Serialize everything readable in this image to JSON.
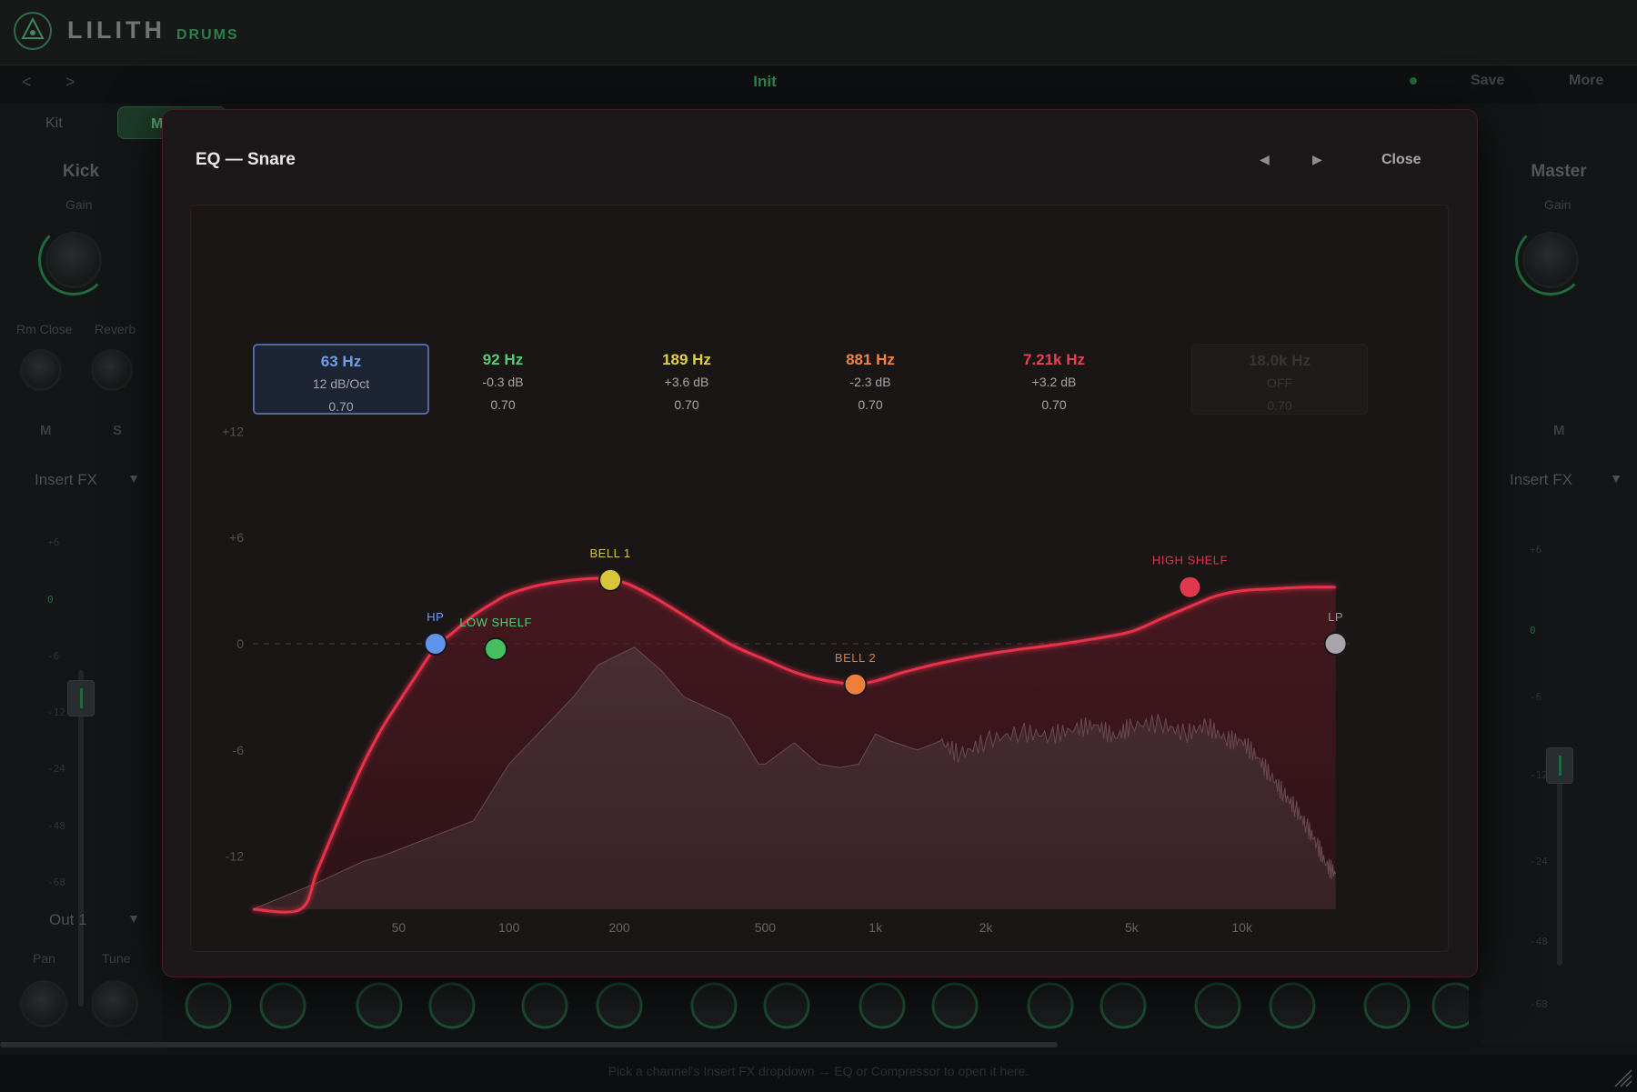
{
  "app": {
    "brand": "LILITH",
    "brand_sub": "DRUMS",
    "preset_name": "Init",
    "prev_label": "<",
    "next_label": ">",
    "save_label": "Save",
    "more_label": "More",
    "tabs": [
      {
        "label": "Kit"
      },
      {
        "label": "M"
      }
    ],
    "status_hint": "Pick a channel's Insert FX dropdown → EQ or Compressor to open it here."
  },
  "channels": {
    "kick": {
      "title": "Kick",
      "gain_label": "Gain",
      "rm_close_label": "Rm Close",
      "reverb_label": "Reverb",
      "mute_label": "M",
      "solo_label": "S",
      "insert_label": "Insert FX",
      "output_label": "Out 1",
      "pan_label": "Pan",
      "tune_label": "Tune",
      "meter_scale": [
        "+6",
        "0",
        "-6",
        "-12",
        "-24",
        "-48",
        "-68"
      ]
    },
    "master": {
      "title": "Master",
      "gain_label": "Gain",
      "mute_label": "M",
      "insert_label": "Insert FX",
      "meter_scale": [
        "+6",
        "0",
        "-6",
        "-12",
        "-24",
        "-48",
        "-68"
      ]
    }
  },
  "eq_modal": {
    "title": "EQ — Snare",
    "prev_icon": "◀",
    "next_icon": "▶",
    "close_label": "Close",
    "bands": [
      {
        "freq": "63 Hz",
        "gain": "12 dB/Oct",
        "q": "0.70",
        "color": "#6f9fe8",
        "state": "active"
      },
      {
        "freq": "92 Hz",
        "gain": "-0.3 dB",
        "q": "0.70",
        "color": "#4fcf72",
        "state": "on"
      },
      {
        "freq": "189 Hz",
        "gain": "+3.6 dB",
        "q": "0.70",
        "color": "#e3cf45",
        "state": "on"
      },
      {
        "freq": "881 Hz",
        "gain": "-2.3 dB",
        "q": "0.70",
        "color": "#ef8540",
        "state": "on"
      },
      {
        "freq": "7.21k Hz",
        "gain": "+3.2 dB",
        "q": "0.70",
        "color": "#e84050",
        "state": "on"
      },
      {
        "freq": "18.0k Hz",
        "gain": "OFF",
        "q": "0.70",
        "color": "#3a3535",
        "state": "off"
      }
    ],
    "nodes": [
      {
        "label": "HP",
        "freq_hz": 63,
        "gain_db": 0,
        "color": "#5e95ea",
        "label_color": "#6f9fe8"
      },
      {
        "label": "LOW SHELF",
        "freq_hz": 92,
        "gain_db": -0.3,
        "color": "#44c060",
        "label_color": "#4fcf72"
      },
      {
        "label": "BELL 1",
        "freq_hz": 189,
        "gain_db": 3.6,
        "color": "#d9c53a",
        "label_color": "#d9c53a"
      },
      {
        "label": "BELL 2",
        "freq_hz": 881,
        "gain_db": -2.3,
        "color": "#ee7f3a",
        "label_color": "#e07a3a"
      },
      {
        "label": "HIGH SHELF",
        "freq_hz": 7210,
        "gain_db": 3.2,
        "color": "#e0394d",
        "label_color": "#d8384c"
      },
      {
        "label": "LP",
        "freq_hz": 18000,
        "gain_db": 0,
        "color": "#a9a3aa",
        "label_color": "#9a9497"
      }
    ],
    "chart_data": {
      "type": "line",
      "x_scale": "log",
      "xlim_hz": [
        20,
        20000
      ],
      "ylim_db": [
        -15,
        15
      ],
      "y_ticks": [
        {
          "value": 12,
          "label": "+12"
        },
        {
          "value": 6,
          "label": "+6"
        },
        {
          "value": 0,
          "label": "0"
        },
        {
          "value": -6,
          "label": "-6"
        },
        {
          "value": -12,
          "label": "-12"
        }
      ],
      "x_ticks": [
        {
          "value": 50,
          "label": "50"
        },
        {
          "value": 100,
          "label": "100"
        },
        {
          "value": 200,
          "label": "200"
        },
        {
          "value": 500,
          "label": "500"
        },
        {
          "value": 1000,
          "label": "1k"
        },
        {
          "value": 2000,
          "label": "2k"
        },
        {
          "value": 5000,
          "label": "5k"
        },
        {
          "value": 10000,
          "label": "10k"
        }
      ],
      "curve_color": "#e8304a",
      "response_curve": {
        "freq_hz": [
          20,
          27,
          30,
          35,
          40,
          45,
          50,
          55,
          63,
          70,
          80,
          92,
          100,
          120,
          150,
          175,
          189,
          210,
          250,
          300,
          400,
          500,
          600,
          700,
          800,
          881,
          1000,
          1200,
          1500,
          2000,
          2500,
          3000,
          4000,
          5000,
          6000,
          7210,
          8500,
          10000,
          12000,
          15000,
          18000
        ],
        "gain_db": [
          -15,
          -15,
          -12.8,
          -9.5,
          -6.8,
          -4.8,
          -3.3,
          -2.0,
          -0.2,
          0.6,
          1.6,
          2.4,
          2.8,
          3.3,
          3.6,
          3.7,
          3.6,
          3.4,
          2.6,
          1.6,
          0.0,
          -0.9,
          -1.6,
          -2.0,
          -2.2,
          -2.3,
          -2.1,
          -1.6,
          -1.1,
          -0.6,
          -0.3,
          -0.1,
          0.3,
          0.7,
          1.4,
          2.1,
          2.7,
          3.0,
          3.1,
          3.2,
          3.2
        ]
      },
      "spectrum": {
        "freq_hz": [
          20,
          30,
          40,
          45,
          60,
          80,
          100,
          150,
          175,
          200,
          220,
          260,
          300,
          400,
          440,
          480,
          500,
          600,
          700,
          800,
          900,
          1000,
          1100,
          1300,
          1500,
          1700,
          2000,
          2500,
          3000,
          3500,
          4000,
          4500,
          5000,
          6000,
          7000,
          8000,
          9000,
          10000,
          11000,
          12000,
          13000,
          14000,
          15000,
          16000,
          17000,
          18000
        ],
        "gain_db": [
          -15,
          -13.5,
          -12.3,
          -12.0,
          -11.0,
          -10.0,
          -6.8,
          -3.0,
          -1.2,
          -0.6,
          -0.2,
          -1.5,
          -3.0,
          -4.2,
          -5.5,
          -6.8,
          -6.8,
          -5.6,
          -6.8,
          -7.0,
          -6.8,
          -5.1,
          -5.5,
          -6.0,
          -5.5,
          -6.3,
          -5.5,
          -5.0,
          -5.2,
          -4.8,
          -4.6,
          -5.3,
          -4.6,
          -4.5,
          -5.1,
          -4.6,
          -5.4,
          -5.5,
          -6.4,
          -7.5,
          -8.5,
          -9.3,
          -10.3,
          -11.3,
          -12.5,
          -13.0
        ]
      }
    }
  }
}
